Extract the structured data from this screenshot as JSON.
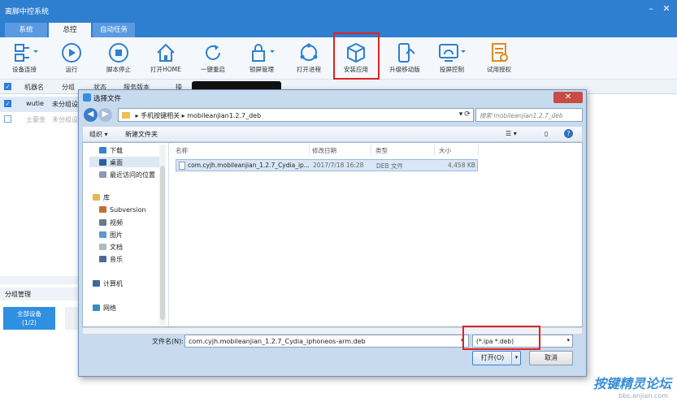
{
  "app": {
    "title": "离脚中控系统"
  },
  "tabs": [
    {
      "label": "系统"
    },
    {
      "label": "总控"
    },
    {
      "label": "自动任务"
    }
  ],
  "toolbar": [
    {
      "label": "设备连接",
      "icon": "device-connect-icon"
    },
    {
      "label": "运行",
      "icon": "play-icon"
    },
    {
      "label": "脚本停止",
      "icon": "stop-icon"
    },
    {
      "label": "打开HOME",
      "icon": "home-icon"
    },
    {
      "label": "一键重启",
      "icon": "restart-icon"
    },
    {
      "label": "锁屏管理",
      "icon": "lock-icon"
    },
    {
      "label": "打开进程",
      "icon": "process-icon"
    },
    {
      "label": "安装应用",
      "icon": "install-app-icon"
    },
    {
      "label": "升级移动版",
      "icon": "upgrade-mobile-icon"
    },
    {
      "label": "投屏控制",
      "icon": "screen-cast-icon"
    },
    {
      "label": "试用授权",
      "icon": "license-icon"
    }
  ],
  "device_list": {
    "headers": [
      "机器名",
      "分组",
      "状态",
      "服务版本",
      "操"
    ],
    "rows": [
      {
        "name": "wutie",
        "group": "未分组设"
      },
      {
        "name": "土豪金",
        "group": "未分组设"
      }
    ]
  },
  "group_panel": {
    "title": "分组管理",
    "all_devices": "全部设备",
    "count": "(1/2)"
  },
  "dialog": {
    "title": "选择文件",
    "breadcrumb": [
      "手机按键相关",
      "mobileanjian1.2.7_deb"
    ],
    "search_placeholder": "搜索 mobileanjian1.2.7_deb",
    "commands": {
      "organize": "组织",
      "new_folder": "新建文件夹"
    },
    "nav_items": [
      {
        "label": "下载",
        "icon": "download-folder-icon"
      },
      {
        "label": "桌面",
        "icon": "desktop-folder-icon"
      },
      {
        "label": "最近访问的位置",
        "icon": "recent-places-icon"
      },
      {
        "label": "库",
        "icon": "library-icon"
      },
      {
        "label": "Subversion",
        "icon": "subversion-icon"
      },
      {
        "label": "视频",
        "icon": "video-icon"
      },
      {
        "label": "图片",
        "icon": "pictures-icon"
      },
      {
        "label": "文档",
        "icon": "documents-icon"
      },
      {
        "label": "音乐",
        "icon": "music-icon"
      },
      {
        "label": "计算机",
        "icon": "computer-icon"
      },
      {
        "label": "网络",
        "icon": "network-icon"
      }
    ],
    "columns": [
      "名称",
      "修改日期",
      "类型",
      "大小"
    ],
    "files": [
      {
        "name": "com.cyjh.mobileanjian_1.2.7_Cydia_ip...",
        "date": "2017/7/18 16:28",
        "type": "DEB 文件",
        "size": "4,458 KB"
      }
    ],
    "filename_label": "文件名(N):",
    "filename_value": "com.cyjh.mobileanjian_1.2.7_Cydia_iphoneos-arm.deb",
    "filetype": "(*.ipa *.deb)",
    "open_label": "打开(O)",
    "cancel_label": "取消"
  },
  "watermark": {
    "text": "按键精灵论坛",
    "url": "bbs.anjian.com"
  },
  "colors": {
    "accent": "#2f7fd0",
    "highlight": "#d22222"
  }
}
